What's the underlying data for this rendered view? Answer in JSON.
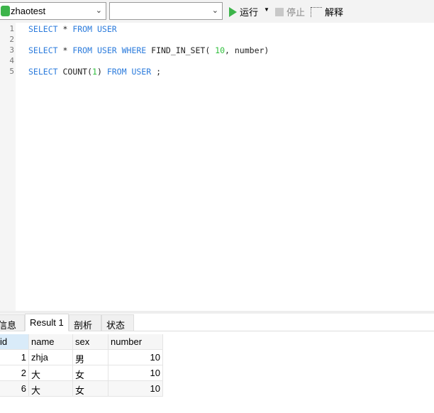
{
  "toolbar": {
    "connection": "zhaotest",
    "schema": "",
    "run_label": "运行",
    "stop_label": "停止",
    "explain_label": "解释"
  },
  "editor": {
    "lines": [
      {
        "n": "1",
        "tokens": [
          [
            "kw",
            "SELECT"
          ],
          [
            "",
            " * "
          ],
          [
            "kw",
            "FROM"
          ],
          [
            "",
            " "
          ],
          [
            "kw",
            "USER"
          ]
        ]
      },
      {
        "n": "2",
        "tokens": []
      },
      {
        "n": "3",
        "tokens": [
          [
            "kw",
            "SELECT"
          ],
          [
            "",
            " * "
          ],
          [
            "kw",
            "FROM"
          ],
          [
            "",
            " "
          ],
          [
            "kw",
            "USER"
          ],
          [
            "",
            " "
          ],
          [
            "kw",
            "WHERE"
          ],
          [
            "",
            " FIND_IN_SET( "
          ],
          [
            "num",
            "10"
          ],
          [
            "",
            ", number)"
          ]
        ]
      },
      {
        "n": "4",
        "tokens": []
      },
      {
        "n": "5",
        "tokens": [
          [
            "kw",
            "SELECT"
          ],
          [
            "",
            " COUNT("
          ],
          [
            "num",
            "1"
          ],
          [
            "",
            ") "
          ],
          [
            "kw",
            "FROM"
          ],
          [
            "",
            " "
          ],
          [
            "kw",
            "USER"
          ],
          [
            "",
            " ;"
          ]
        ]
      }
    ]
  },
  "result_tabs": [
    "信息",
    "Result 1",
    "剖析",
    "状态"
  ],
  "active_tab": "Result 1",
  "table": {
    "columns": [
      "id",
      "name",
      "sex",
      "number"
    ],
    "rows": [
      [
        "1",
        "zhja",
        "男",
        "10"
      ],
      [
        "2",
        "大",
        "女",
        "10"
      ],
      [
        "6",
        "大",
        "女",
        "10"
      ]
    ]
  },
  "colors": {
    "keyword": "#2b7bdc",
    "number": "#2fbf3c",
    "run": "#3cb44a"
  }
}
